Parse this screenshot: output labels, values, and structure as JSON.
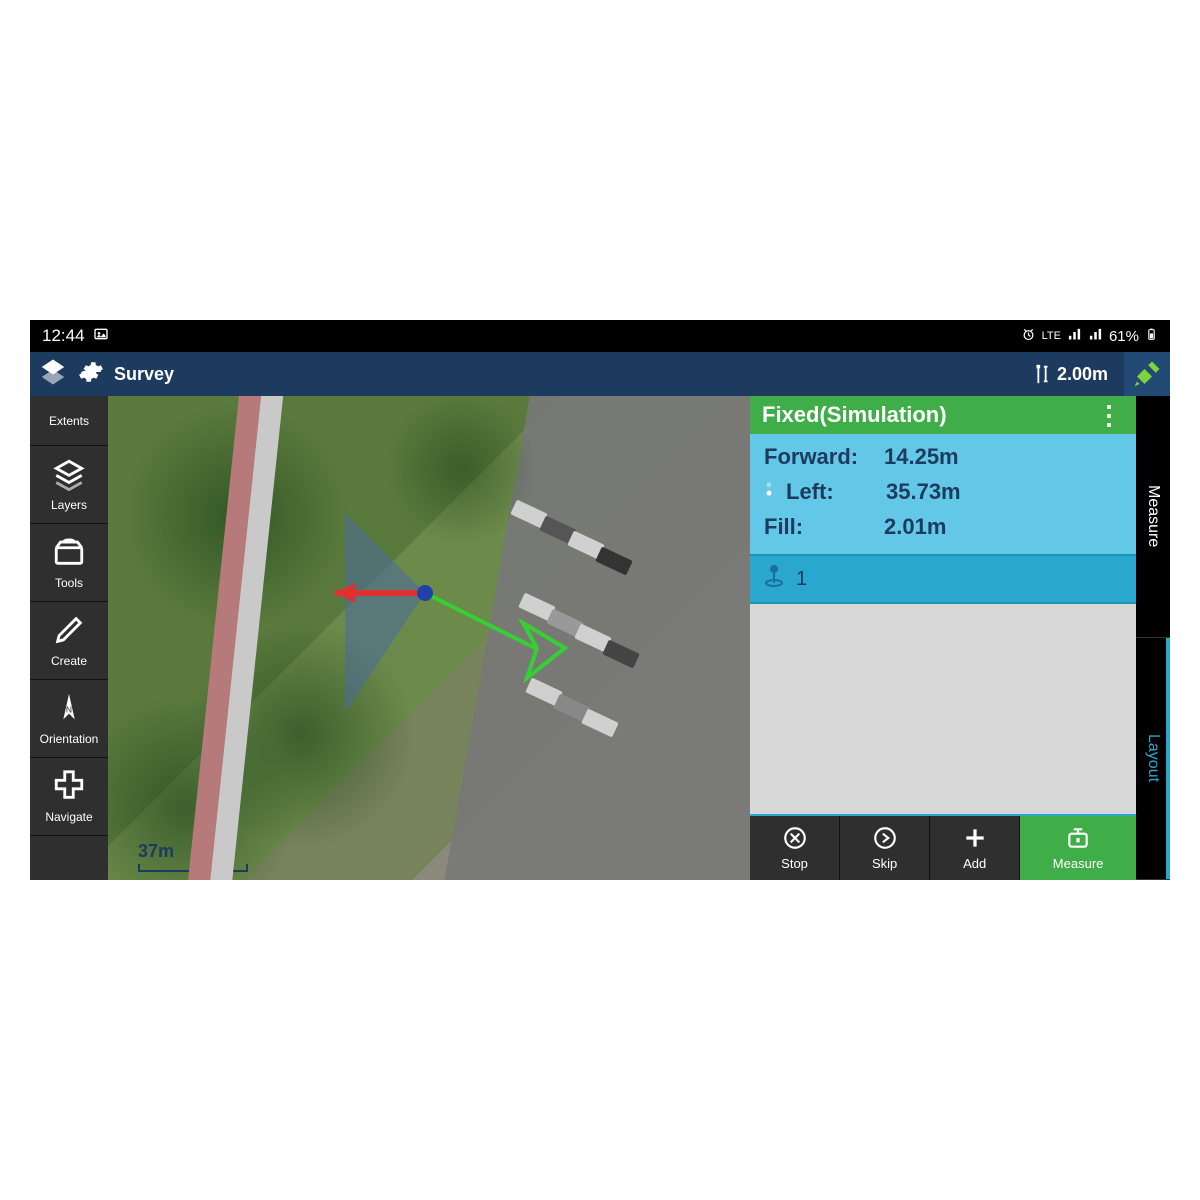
{
  "status": {
    "time": "12:44",
    "battery": "61%",
    "net": "LTE"
  },
  "header": {
    "title": "Survey",
    "pole_height": "2.00m"
  },
  "left_toolbar": {
    "items": [
      {
        "label": "Extents"
      },
      {
        "label": "Layers"
      },
      {
        "label": "Tools"
      },
      {
        "label": "Create"
      },
      {
        "label": "Orientation"
      },
      {
        "label": "Navigate"
      }
    ]
  },
  "map": {
    "scale_label": "37m"
  },
  "panel": {
    "status": "Fixed(Simulation)",
    "forward": {
      "label": "Forward:",
      "value": "14.25m"
    },
    "left": {
      "label": "Left:",
      "value": "35.73m"
    },
    "fill": {
      "label": "Fill:",
      "value": "2.01m"
    },
    "item_id": "1",
    "actions": {
      "stop": "Stop",
      "skip": "Skip",
      "add": "Add",
      "measure": "Measure"
    }
  },
  "tabs": {
    "measure": "Measure",
    "layout": "Layout"
  }
}
